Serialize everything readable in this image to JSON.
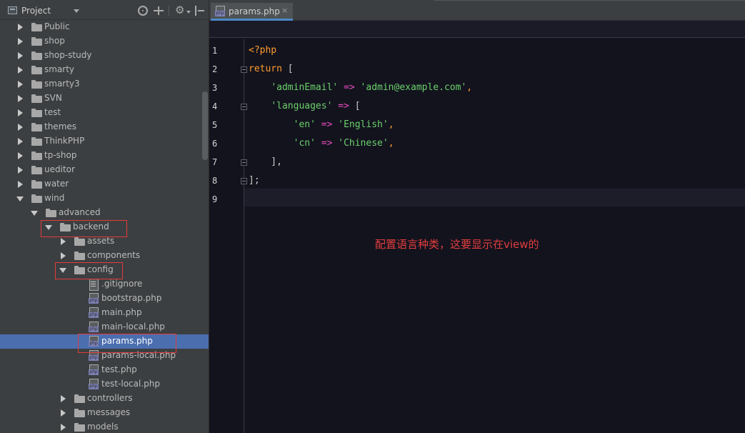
{
  "project_panel": {
    "title": "Project",
    "tree": [
      {
        "label": "Public",
        "type": "folder",
        "state": "collapsed",
        "depth": 0
      },
      {
        "label": "shop",
        "type": "folder",
        "state": "collapsed",
        "depth": 0
      },
      {
        "label": "shop-study",
        "type": "folder",
        "state": "collapsed",
        "depth": 0
      },
      {
        "label": "smarty",
        "type": "folder",
        "state": "collapsed",
        "depth": 0
      },
      {
        "label": "smarty3",
        "type": "folder",
        "state": "collapsed",
        "depth": 0
      },
      {
        "label": "SVN",
        "type": "folder",
        "state": "collapsed",
        "depth": 0
      },
      {
        "label": "test",
        "type": "folder",
        "state": "collapsed",
        "depth": 0
      },
      {
        "label": "themes",
        "type": "folder",
        "state": "collapsed",
        "depth": 0
      },
      {
        "label": "ThinkPHP",
        "type": "folder",
        "state": "collapsed",
        "depth": 0
      },
      {
        "label": "tp-shop",
        "type": "folder",
        "state": "collapsed",
        "depth": 0
      },
      {
        "label": "ueditor",
        "type": "folder",
        "state": "collapsed",
        "depth": 0
      },
      {
        "label": "water",
        "type": "folder",
        "state": "collapsed",
        "depth": 0
      },
      {
        "label": "wind",
        "type": "folder",
        "state": "expanded",
        "depth": 0
      },
      {
        "label": "advanced",
        "type": "folder",
        "state": "expanded",
        "depth": 1
      },
      {
        "label": "backend",
        "type": "folder",
        "state": "expanded",
        "depth": 2,
        "highlighted": true
      },
      {
        "label": "assets",
        "type": "folder",
        "state": "collapsed",
        "depth": 3
      },
      {
        "label": "components",
        "type": "folder",
        "state": "collapsed",
        "depth": 3
      },
      {
        "label": "config",
        "type": "folder",
        "state": "expanded",
        "depth": 3,
        "highlighted": true
      },
      {
        "label": ".gitignore",
        "type": "text",
        "depth": 4
      },
      {
        "label": "bootstrap.php",
        "type": "php",
        "depth": 4
      },
      {
        "label": "main.php",
        "type": "php",
        "depth": 4
      },
      {
        "label": "main-local.php",
        "type": "php",
        "depth": 4
      },
      {
        "label": "params.php",
        "type": "php",
        "depth": 4,
        "selected": true,
        "highlighted": true
      },
      {
        "label": "params-local.php",
        "type": "php",
        "depth": 4
      },
      {
        "label": "test.php",
        "type": "php",
        "depth": 4
      },
      {
        "label": "test-local.php",
        "type": "php",
        "depth": 4
      },
      {
        "label": "controllers",
        "type": "folder",
        "state": "collapsed",
        "depth": 3
      },
      {
        "label": "messages",
        "type": "folder",
        "state": "collapsed",
        "depth": 3
      },
      {
        "label": "models",
        "type": "folder",
        "state": "collapsed",
        "depth": 3
      }
    ]
  },
  "editor": {
    "tab": {
      "label": "params.php",
      "close": "×"
    },
    "current_line": 9,
    "lines": [
      {
        "num": "1",
        "tokens": [
          {
            "t": "<?php",
            "c": "tag"
          }
        ]
      },
      {
        "num": "2",
        "tokens": [
          {
            "t": "return",
            "c": "kw"
          },
          {
            "t": " [",
            "c": "punc"
          }
        ]
      },
      {
        "num": "3",
        "tokens": [
          {
            "t": "    ",
            "c": "punc"
          },
          {
            "t": "'adminEmail'",
            "c": "str"
          },
          {
            "t": " ",
            "c": "punc"
          },
          {
            "t": "=>",
            "c": "op"
          },
          {
            "t": " ",
            "c": "punc"
          },
          {
            "t": "'admin@example.com'",
            "c": "str"
          },
          {
            "t": ",",
            "c": "tag"
          }
        ]
      },
      {
        "num": "4",
        "tokens": [
          {
            "t": "    ",
            "c": "punc"
          },
          {
            "t": "'languages'",
            "c": "str"
          },
          {
            "t": " ",
            "c": "punc"
          },
          {
            "t": "=>",
            "c": "op"
          },
          {
            "t": " [",
            "c": "punc"
          }
        ]
      },
      {
        "num": "5",
        "tokens": [
          {
            "t": "        ",
            "c": "punc"
          },
          {
            "t": "'en'",
            "c": "str"
          },
          {
            "t": " ",
            "c": "punc"
          },
          {
            "t": "=>",
            "c": "op"
          },
          {
            "t": " ",
            "c": "punc"
          },
          {
            "t": "'English'",
            "c": "str"
          },
          {
            "t": ",",
            "c": "tag"
          }
        ]
      },
      {
        "num": "6",
        "tokens": [
          {
            "t": "        ",
            "c": "punc"
          },
          {
            "t": "'cn'",
            "c": "str"
          },
          {
            "t": " ",
            "c": "punc"
          },
          {
            "t": "=>",
            "c": "op"
          },
          {
            "t": " ",
            "c": "punc"
          },
          {
            "t": "'Chinese'",
            "c": "str"
          },
          {
            "t": ",",
            "c": "tag"
          }
        ]
      },
      {
        "num": "7",
        "tokens": [
          {
            "t": "    ],",
            "c": "punc"
          }
        ]
      },
      {
        "num": "8",
        "tokens": [
          {
            "t": "];",
            "c": "punc"
          }
        ]
      },
      {
        "num": "9",
        "tokens": []
      }
    ],
    "annotation": "配置语言种类，这要显示在view的"
  },
  "colors": {
    "selection": "#4b6eaf",
    "highlight_box": "#e23b3b",
    "editor_bg": "#13131e",
    "string": "#6ad16a",
    "keyword": "#ff9c2e",
    "operator": "#eb4ec0"
  }
}
